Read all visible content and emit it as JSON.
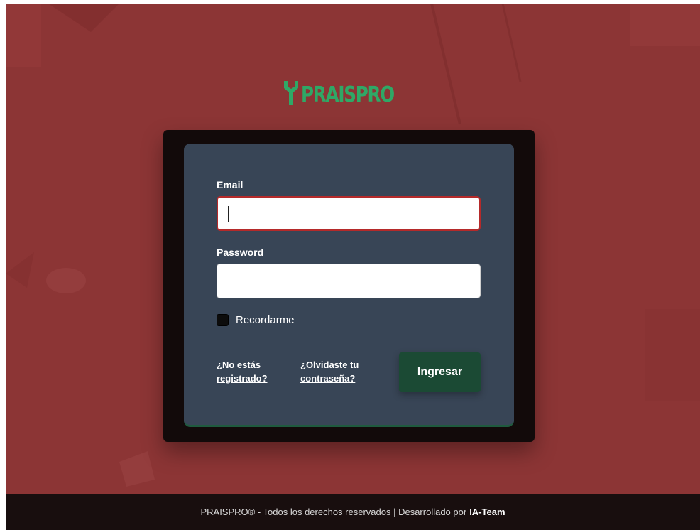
{
  "brand": {
    "name": "PRAISPRO",
    "color": "#2fa866"
  },
  "login_form": {
    "email_label": "Email",
    "email_value": "",
    "password_label": "Password",
    "password_value": "",
    "remember_label": "Recordarme",
    "remember_checked": false,
    "register_link": "¿No estás registrado?",
    "forgot_link": "¿Olvidaste tu contraseña?",
    "submit_label": "Ingresar"
  },
  "footer": {
    "text": "PRAISPRO® - Todos los derechos reservados | Desarrollado por",
    "team": "IA-Team"
  },
  "colors": {
    "background": "#8c3535",
    "card": "#384556",
    "panel": "#120a0a",
    "button": "#1b4a34",
    "focus_border": "#b52a2a",
    "footer": "#180e0e"
  },
  "icons": {
    "logo": "wrench-icon"
  }
}
